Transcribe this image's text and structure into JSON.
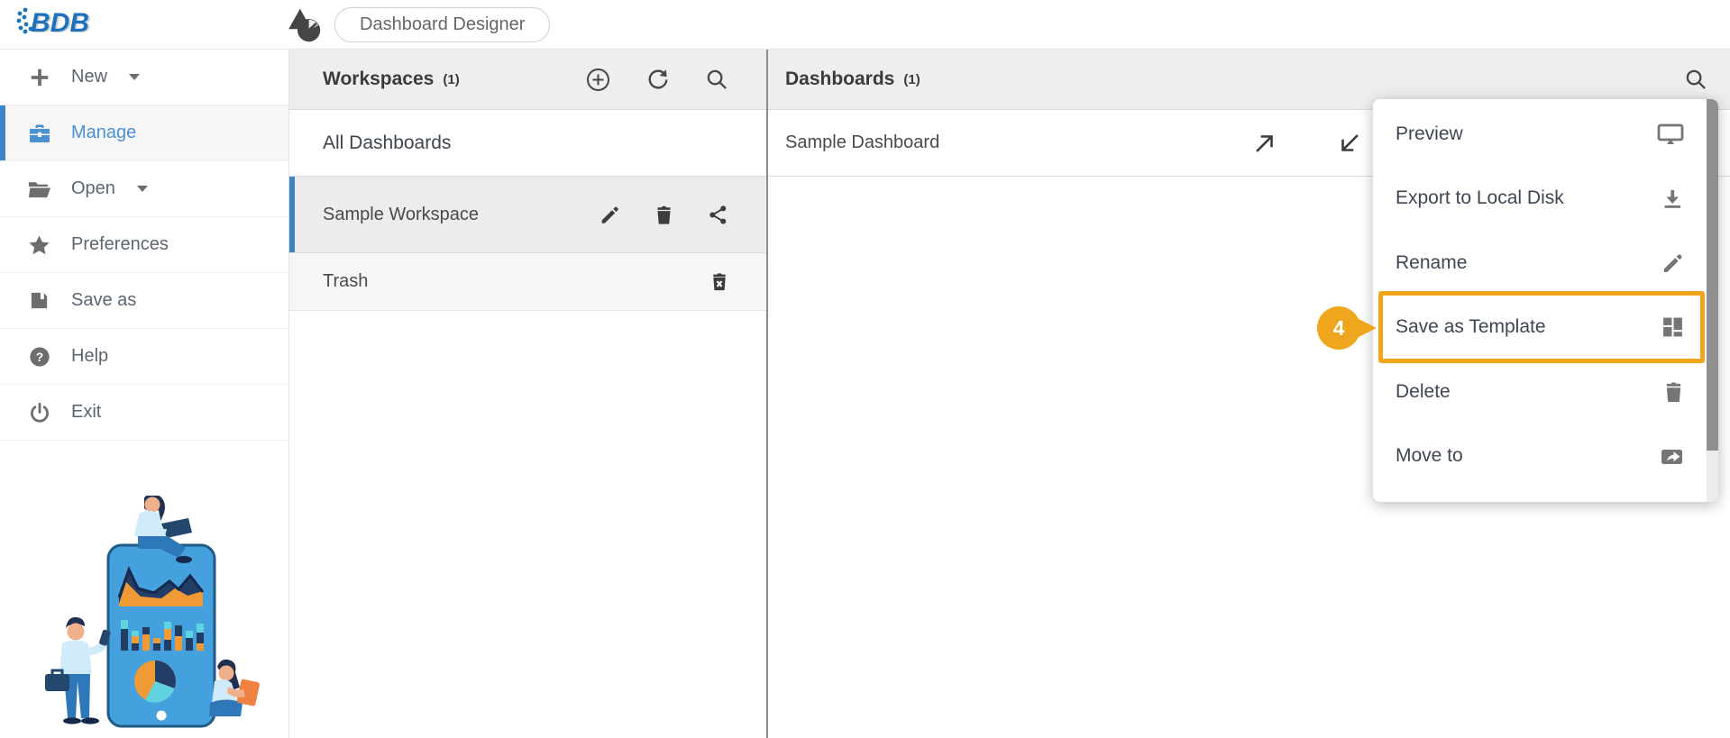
{
  "app": {
    "logo_text": "BDB",
    "module_pill": "Dashboard Designer"
  },
  "colors": {
    "accent_blue": "#3d85c6",
    "active_text_blue": "#4a90d2",
    "highlight_orange": "#efa51c",
    "panel_header_bg": "#eeeeee",
    "selected_row_bg": "#ececec",
    "logo_blue": "#1e72bd"
  },
  "sidebar": {
    "items": [
      {
        "label": "New",
        "icon": "plus-icon",
        "has_caret": true,
        "active": false
      },
      {
        "label": "Manage",
        "icon": "briefcase-icon",
        "has_caret": false,
        "active": true
      },
      {
        "label": "Open",
        "icon": "folder-open-icon",
        "has_caret": true,
        "active": false
      },
      {
        "label": "Preferences",
        "icon": "star-icon",
        "has_caret": false,
        "active": false
      },
      {
        "label": "Save as",
        "icon": "save-icon",
        "has_caret": false,
        "active": false
      },
      {
        "label": "Help",
        "icon": "help-icon",
        "has_caret": false,
        "active": false
      },
      {
        "label": "Exit",
        "icon": "power-icon",
        "has_caret": false,
        "active": false
      }
    ]
  },
  "workspaces_panel": {
    "title": "Workspaces",
    "count": "(1)",
    "toolbar": [
      {
        "icon": "add-circle-icon"
      },
      {
        "icon": "refresh-icon"
      },
      {
        "icon": "search-icon"
      }
    ],
    "rows": [
      {
        "label": "All Dashboards",
        "selected": false,
        "icons": []
      },
      {
        "label": "Sample Workspace",
        "selected": true,
        "icons": [
          "edit-icon",
          "delete-icon",
          "share-icon"
        ]
      },
      {
        "label": "Trash",
        "selected": false,
        "icons": [
          "empty-trash-icon"
        ]
      }
    ]
  },
  "dashboards_panel": {
    "title": "Dashboards",
    "count": "(1)",
    "toolbar": [
      {
        "icon": "search-icon"
      }
    ],
    "rows": [
      {
        "label": "Sample Dashboard",
        "icons": [
          "open-in-new-tab-icon",
          "open-here-icon"
        ]
      }
    ]
  },
  "context_menu": {
    "step_badge": "4",
    "highlighted_item": "Save as Template",
    "items": [
      {
        "label": "Preview",
        "icon": "monitor-icon"
      },
      {
        "label": "Export to Local Disk",
        "icon": "download-icon"
      },
      {
        "label": "Rename",
        "icon": "pencil-icon"
      },
      {
        "label": "Save as Template",
        "icon": "template-grid-icon"
      },
      {
        "label": "Delete",
        "icon": "trash-icon"
      },
      {
        "label": "Move to",
        "icon": "move-to-icon"
      }
    ]
  }
}
